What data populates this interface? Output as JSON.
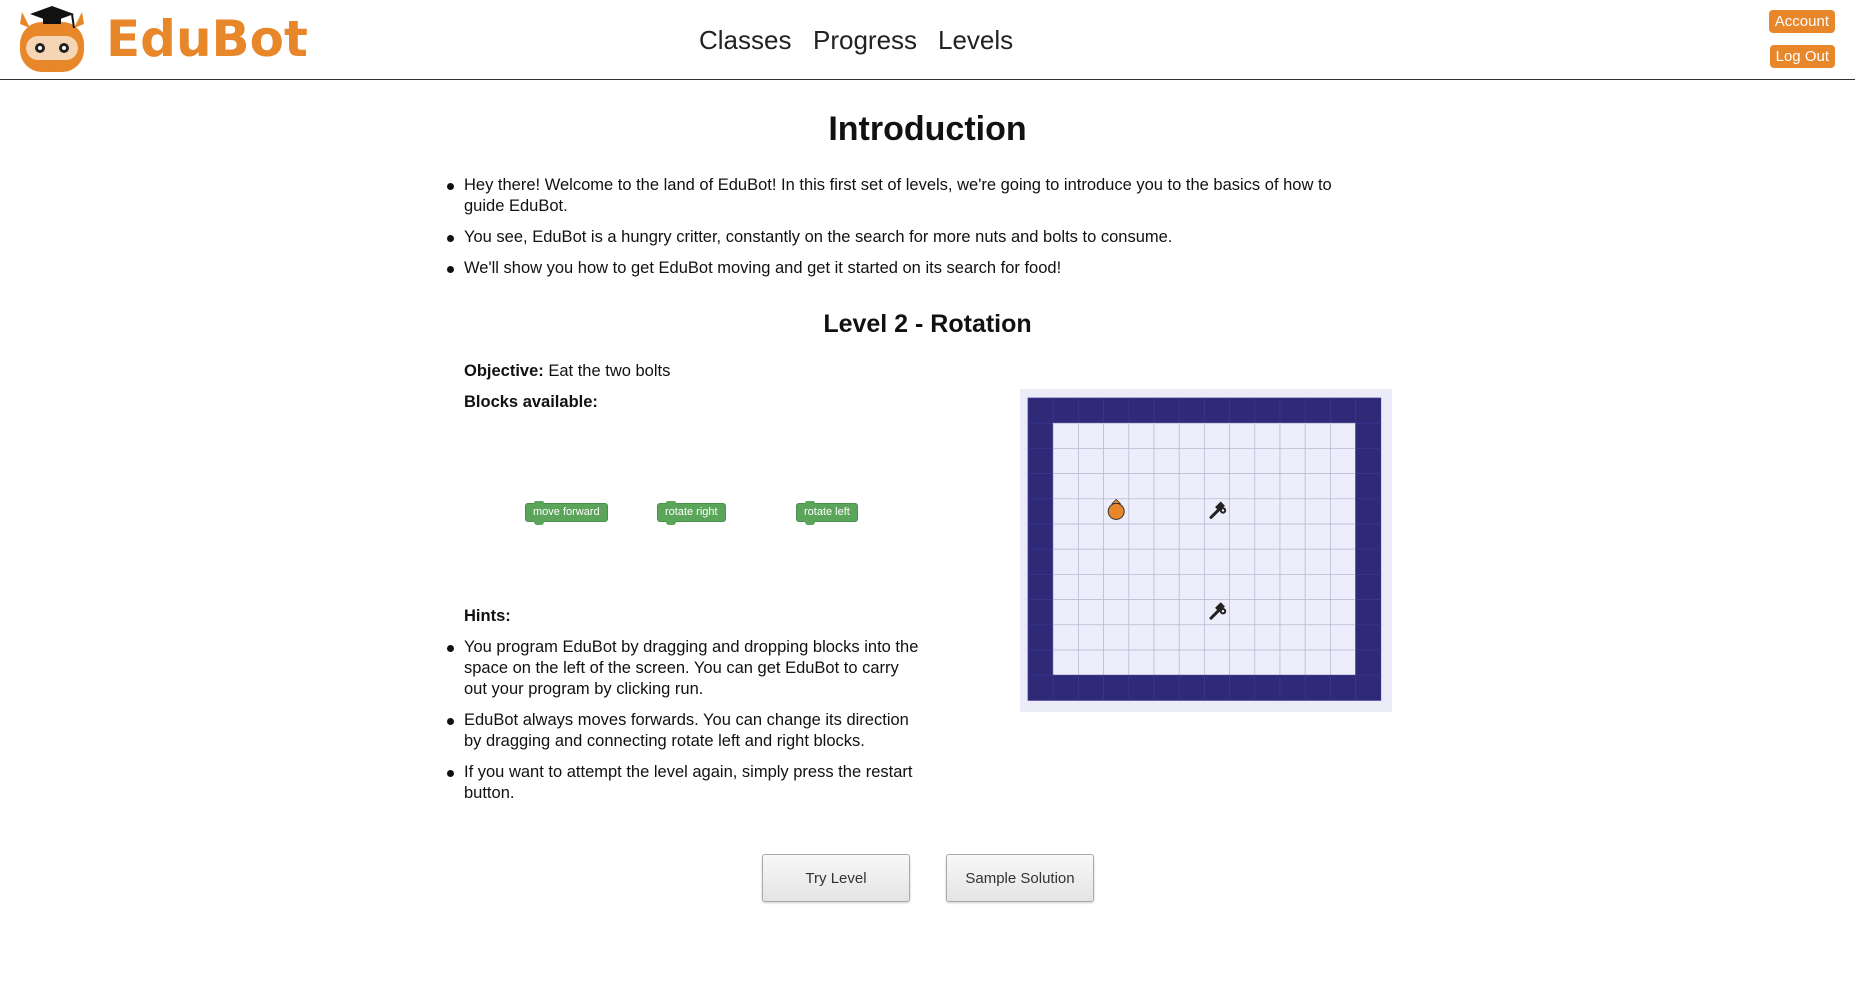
{
  "app": {
    "brand": "EduBot"
  },
  "nav": {
    "classes": "Classes",
    "progress": "Progress",
    "levels": "Levels"
  },
  "account": {
    "account_label": "Account",
    "logout_label": "Log Out"
  },
  "intro": {
    "title": "Introduction",
    "items": [
      "Hey there! Welcome to the land of EduBot! In this first set of levels, we're going to introduce you to the basics of how to guide EduBot.",
      "You see, EduBot is a hungry critter, constantly on the search for more nuts and bolts to consume.",
      "We'll show you how to get EduBot moving and get it started on its search for food!"
    ]
  },
  "level": {
    "title": "Level 2 - Rotation",
    "objective_label": "Objective:",
    "objective_text": "Eat the two bolts",
    "blocks_label": "Blocks available:",
    "blocks": [
      "move forward",
      "rotate right",
      "rotate left"
    ],
    "hints_label": "Hints:",
    "hints": [
      "You program EduBot by dragging and dropping blocks into the space on the left of the screen. You can get EduBot to carry out your program by clicking run.",
      "EduBot always moves forwards. You can change its direction by dragging and connecting rotate left and right blocks.",
      "If you want to attempt the level again, simply press the restart button."
    ]
  },
  "board": {
    "wall_color": "#2e2a78",
    "floor_color": "#ededfb",
    "robot_color": "#e8862a",
    "robot_icon": "edubot-robot-icon",
    "bolt_icon": "bolt-icon"
  },
  "actions": {
    "try_level": "Try Level",
    "sample_solution": "Sample Solution"
  },
  "colors": {
    "accent": "#e8862a",
    "block_green": "#5ba55b"
  }
}
